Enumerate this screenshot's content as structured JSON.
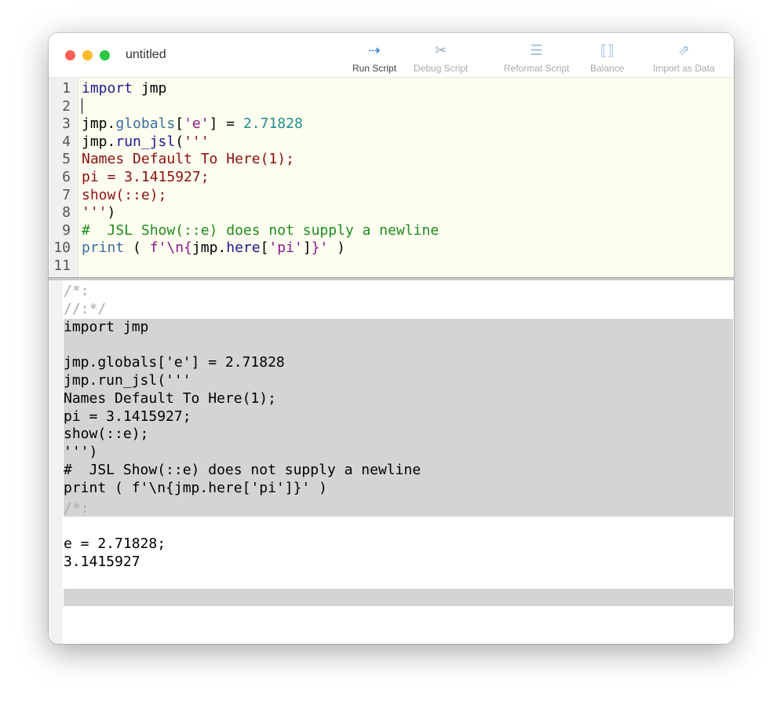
{
  "window": {
    "title": "untitled"
  },
  "toolbar": [
    {
      "label": "Run Script",
      "icon": "run-script-icon",
      "enabled": true
    },
    {
      "label": "Debug Script",
      "icon": "debug-script-icon",
      "enabled": false
    },
    {
      "label": "Reformat Script",
      "icon": "reformat-script-icon",
      "enabled": false
    },
    {
      "label": "Balance",
      "icon": "balance-icon",
      "enabled": false
    },
    {
      "label": "Import as Data",
      "icon": "import-as-data-icon",
      "enabled": false
    }
  ],
  "editor": {
    "lines": [
      [
        [
          "k",
          "import"
        ],
        [
          "d",
          " jmp"
        ]
      ],
      [],
      [
        [
          "d",
          "jmp."
        ],
        [
          "f",
          "globals"
        ],
        [
          "d",
          "["
        ],
        [
          "m",
          "'e'"
        ],
        [
          "d",
          "] = "
        ],
        [
          "n",
          "2.71828"
        ]
      ],
      [
        [
          "d",
          "jmp."
        ],
        [
          "k",
          "run_jsl"
        ],
        [
          "d",
          "("
        ],
        [
          "s",
          "'''"
        ]
      ],
      [
        [
          "s",
          "Names Default To Here(1);"
        ]
      ],
      [
        [
          "s",
          "pi = 3.1415927;"
        ]
      ],
      [
        [
          "s",
          "show(::e);"
        ]
      ],
      [
        [
          "s",
          "'''"
        ],
        [
          "d",
          ")"
        ]
      ],
      [
        [
          "c",
          "#  JSL Show(::e) does not supply a newline"
        ]
      ],
      [
        [
          "f",
          "print"
        ],
        [
          "d",
          " ( "
        ],
        [
          "m",
          "f'\\n{"
        ],
        [
          "d",
          "jmp."
        ],
        [
          "k",
          "here"
        ],
        [
          "d",
          "["
        ],
        [
          "m",
          "'pi'"
        ],
        [
          "d",
          "]"
        ],
        [
          "m",
          "}'"
        ],
        [
          "d",
          " )"
        ]
      ],
      []
    ]
  },
  "output": {
    "header": [
      "/*:",
      "//:*/"
    ],
    "echo": [
      "import jmp",
      "",
      "jmp.globals['e'] = 2.71828",
      "jmp.run_jsl('''",
      "Names Default To Here(1);",
      "pi = 3.1415927;",
      "show(::e);",
      "''')",
      "#  JSL Show(::e) does not supply a newline",
      "print ( f'\\n{jmp.here['pi']}' )"
    ],
    "marker": "/*:",
    "results": [
      "",
      "e = 2.71828;",
      "3.1415927"
    ]
  }
}
